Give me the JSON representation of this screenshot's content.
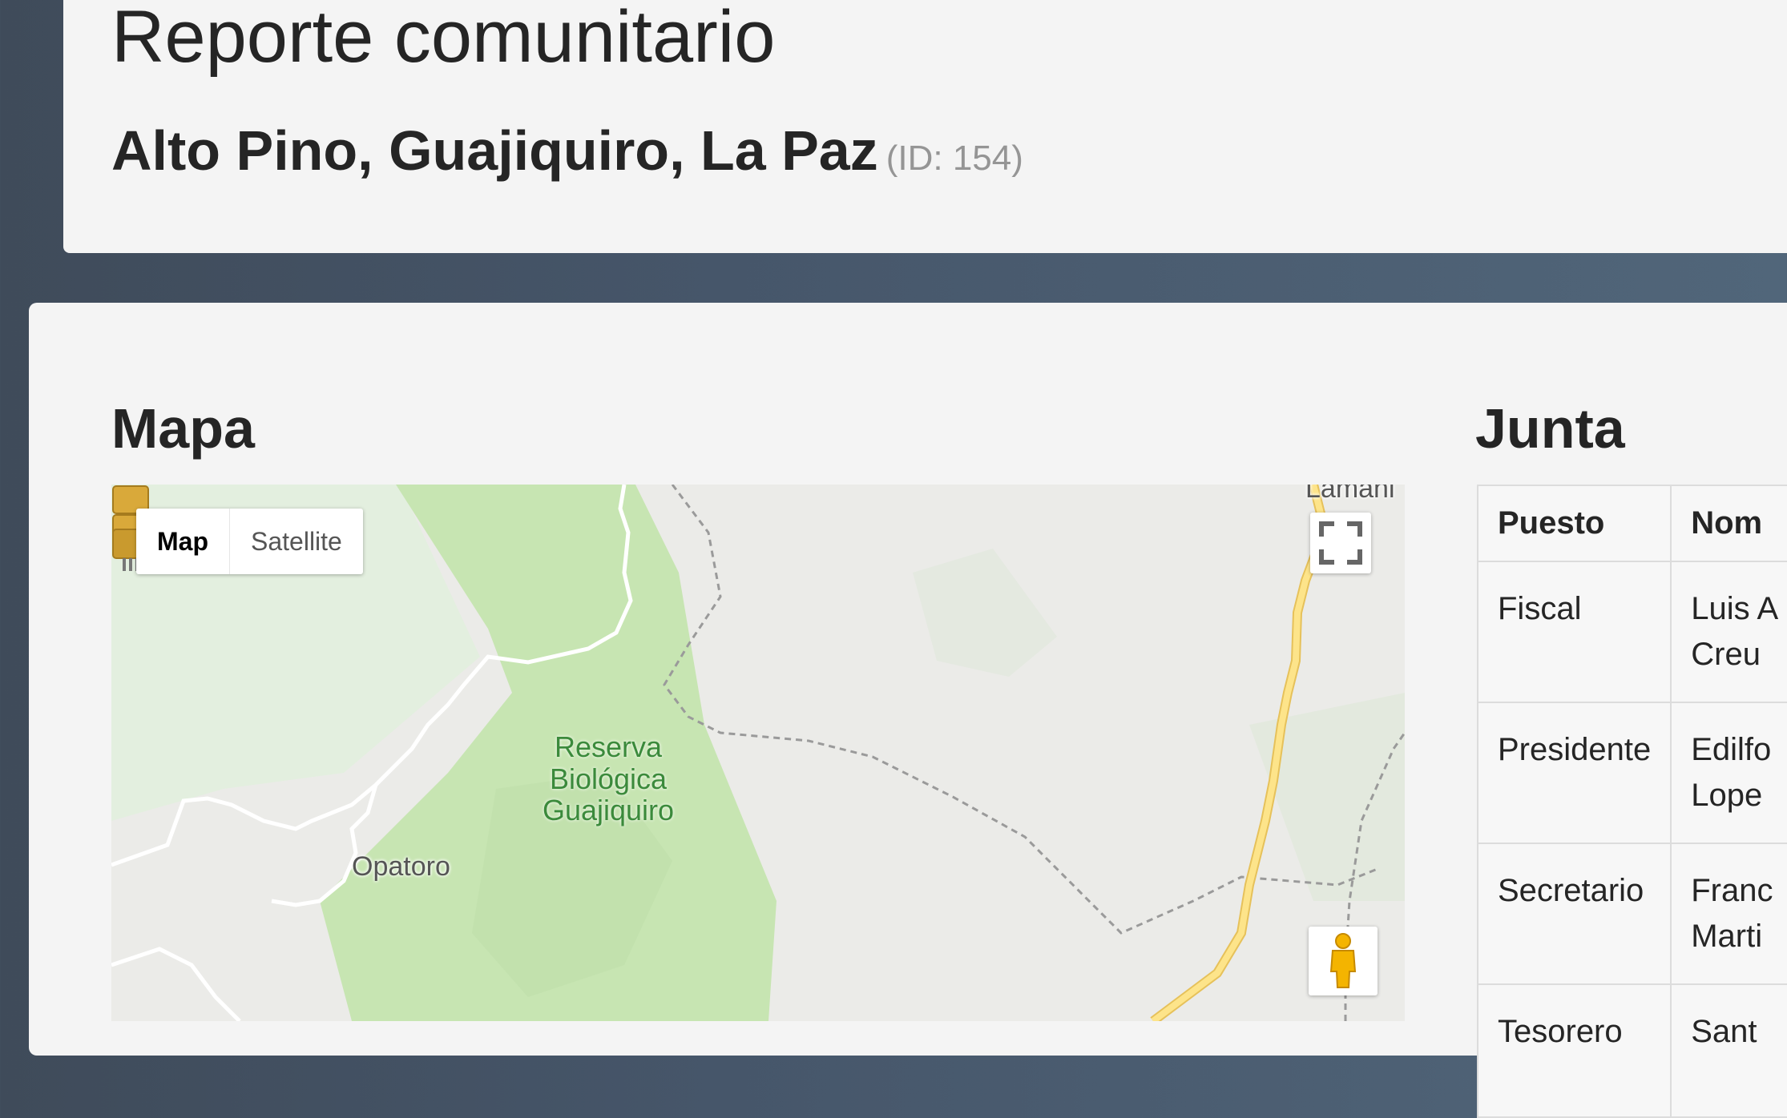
{
  "header": {
    "title": "Reporte comunitario",
    "location": "Alto Pino, Guajiquiro, La Paz",
    "id_label": "(ID: 154)"
  },
  "map_section": {
    "title": "Mapa",
    "map_type_buttons": [
      "Map",
      "Satellite"
    ],
    "active_map_type": "Map",
    "labels": {
      "park": [
        "Reserva",
        "Biológica",
        "Guajiquiro"
      ],
      "town_1": "Opatoro",
      "town_2": "Lamani"
    },
    "icons": [
      "fullscreen-icon",
      "pegman-icon",
      "community-marker-icon"
    ]
  },
  "junta_section": {
    "title": "Junta",
    "columns": [
      "Puesto",
      "Nom"
    ],
    "rows": [
      {
        "puesto": "Fiscal",
        "nombre_line1": "Luis A",
        "nombre_line2": "Creu"
      },
      {
        "puesto": "Presidente",
        "nombre_line1": "Edilfo",
        "nombre_line2": "Lope"
      },
      {
        "puesto": "Secretario",
        "nombre_line1": "Franc",
        "nombre_line2": "Marti"
      },
      {
        "puesto": "Tesorero",
        "nombre_line1": "Sant",
        "nombre_line2": ""
      }
    ]
  },
  "colors": {
    "background": "#46566a",
    "panel": "#f4f4f4",
    "park_green": "#c8e6b4",
    "road_yellow": "#f9d56a",
    "muted_text": "#959595"
  }
}
